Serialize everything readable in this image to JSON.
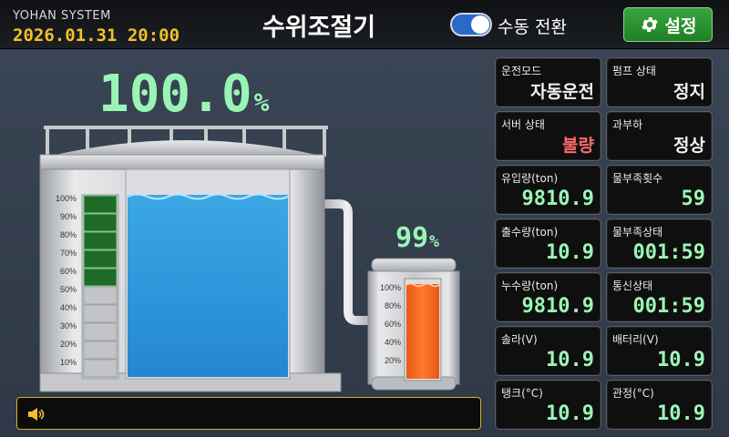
{
  "header": {
    "brand": "YOHAN SYSTEM",
    "datetime": "2026.01.31 20:00",
    "title": "수위조절기",
    "toggle_label": "수동 전환",
    "settings_label": "설정"
  },
  "tank": {
    "level_value": "100.0",
    "level_unit": "%",
    "scale_labels": [
      "100%",
      "90%",
      "80%",
      "70%",
      "60%",
      "50%",
      "40%",
      "30%",
      "20%",
      "10%"
    ],
    "bar_fill_percent": 50
  },
  "pump_tank": {
    "level_value": "99",
    "level_unit": "%",
    "scale_labels": [
      "100%",
      "80%",
      "60%",
      "40%",
      "20%"
    ]
  },
  "message": {
    "text": ""
  },
  "panels": [
    {
      "label": "운전모드",
      "value": "자동운전",
      "style": "text"
    },
    {
      "label": "펌프 상태",
      "value": "정지",
      "style": "text"
    },
    {
      "label": "서버 상태",
      "value": "불량",
      "style": "red"
    },
    {
      "label": "과부하",
      "value": "정상",
      "style": "text"
    },
    {
      "label": "유입량(ton)",
      "value": "9810.9",
      "style": "mono"
    },
    {
      "label": "물부족횟수",
      "value": "59",
      "style": "mono"
    },
    {
      "label": "출수량(ton)",
      "value": "10.9",
      "style": "mono"
    },
    {
      "label": "물부족상태",
      "value": "001:59",
      "style": "mono"
    },
    {
      "label": "누수량(ton)",
      "value": "9810.9",
      "style": "mono"
    },
    {
      "label": "통신상태",
      "value": "001:59",
      "style": "mono"
    },
    {
      "label": "솔라(V)",
      "value": "10.9",
      "style": "mono"
    },
    {
      "label": "배터리(V)",
      "value": "10.9",
      "style": "mono"
    },
    {
      "label": "탱크(°C)",
      "value": "10.9",
      "style": "mono"
    },
    {
      "label": "관정(°C)",
      "value": "10.9",
      "style": "mono"
    }
  ],
  "colors": {
    "accent_green": "#9af5b4",
    "water_blue": "#2f9bdc",
    "pump_orange": "#f36b1f",
    "header_yellow": "#f2c02c",
    "settings_green": "#2a9a32",
    "toggle_blue": "#2a69c8",
    "level_bar_green": "#1e6b26"
  },
  "icons": {
    "settings": "gear-icon",
    "message": "speaker-icon",
    "toggle": "toggle-switch"
  }
}
